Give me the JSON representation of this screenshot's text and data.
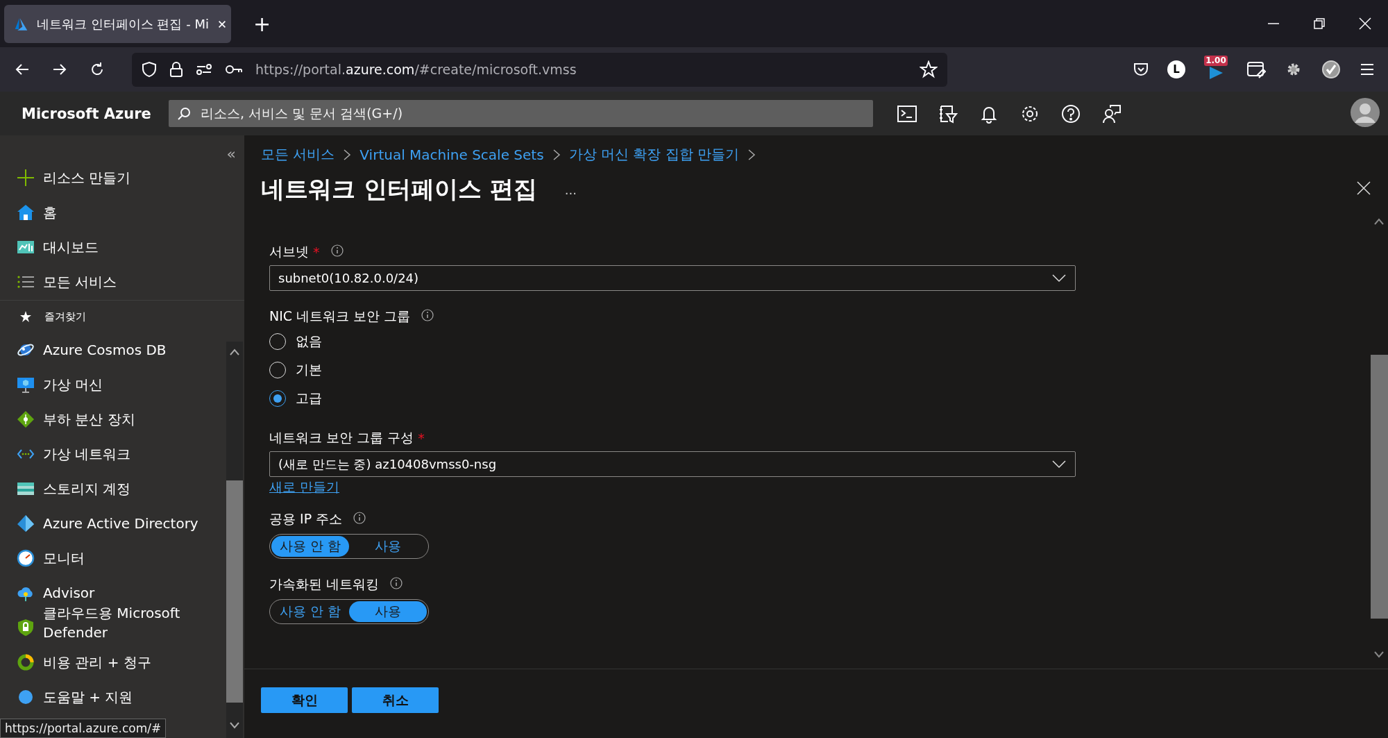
{
  "browser": {
    "tab": {
      "title": "네트워크 인터페이스 편집 - Mi",
      "selected": true
    },
    "new_tab": "+",
    "url": {
      "prefix": "https://portal.",
      "host": "azure.com",
      "path": "/#create/microsoft.vmss"
    },
    "extension_badge": "1.00",
    "profile_initial": "L"
  },
  "portal": {
    "brand": "Microsoft Azure",
    "search": {
      "placeholder": "리소스, 서비스 및 문서 검색(G+/)"
    }
  },
  "sidebar": {
    "collapse": "«",
    "items": [
      {
        "label": "리소스 만들기"
      },
      {
        "label": "홈"
      },
      {
        "label": "대시보드"
      },
      {
        "label": "모든 서비스"
      }
    ],
    "favorites_title": "즐겨찾기",
    "favorites": [
      {
        "label": "Azure Cosmos DB"
      },
      {
        "label": "가상 머신"
      },
      {
        "label": "부하 분산 장치"
      },
      {
        "label": "가상 네트워크"
      },
      {
        "label": "스토리지 계정"
      },
      {
        "label": "Azure Active Directory"
      },
      {
        "label": "모니터"
      },
      {
        "label": "Advisor"
      },
      {
        "label": "클라우드용 Microsoft Defender"
      },
      {
        "label": "비용 관리 + 청구"
      },
      {
        "label": "도움말 + 지원"
      }
    ]
  },
  "status_url": "https://portal.azure.com/#",
  "blade": {
    "breadcrumb": [
      "모든 서비스",
      "Virtual Machine Scale Sets",
      "가상 머신 확장 집합 만들기"
    ],
    "title": "네트워크 인터페이스 편집",
    "more": "...",
    "fields": [
      {
        "kind": "dropdown",
        "label": "서브넷",
        "required_mark": "*",
        "info": true,
        "value": "subnet0(10.82.0.0/24)"
      },
      {
        "kind": "radio",
        "label": "NIC 네트워크 보안 그룹",
        "info": true,
        "options": [
          {
            "label": "없음",
            "selected": false
          },
          {
            "label": "기본",
            "selected": false
          },
          {
            "label": "고급",
            "selected": true
          }
        ]
      },
      {
        "kind": "dropdown",
        "label": "네트워크 보안 그룹 구성",
        "required_mark": "*",
        "info": false,
        "value": "(새로 만드는 중) az10408vmss0-nsg",
        "link": "새로 만들기"
      },
      {
        "kind": "toggle",
        "label": "공용 IP 주소",
        "info": true,
        "options": [
          {
            "label": "사용 안 함",
            "selected": true
          },
          {
            "label": "사용",
            "selected": false
          }
        ]
      },
      {
        "kind": "toggle",
        "label": "가속화된 네트워킹",
        "info": true,
        "options": [
          {
            "label": "사용 안 함",
            "selected": false
          },
          {
            "label": "사용",
            "selected": true
          }
        ]
      }
    ],
    "buttons": [
      "확인",
      "취소"
    ]
  }
}
